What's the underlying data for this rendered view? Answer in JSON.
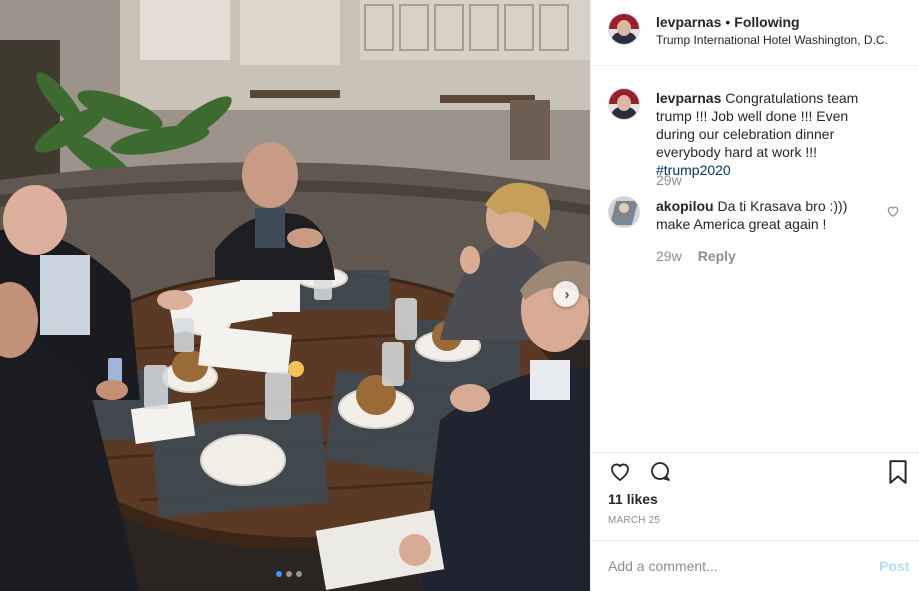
{
  "post": {
    "username": "levparnas",
    "separator": "•",
    "follow_status": "Following",
    "location": "Trump International Hotel Washington, D.C.",
    "photo_dots": 3,
    "active_dot": 0
  },
  "caption": {
    "username": "levparnas",
    "text": "Congratulations team trump !!! Job well done !!! Even during our celebration dinner everybody hard at work !!!",
    "hashtag": "#trump2020",
    "time": "29w"
  },
  "comments": [
    {
      "username": "akopilou",
      "text": "Da ti Krasava bro :))) make America great again !",
      "time": "29w",
      "reply_label": "Reply"
    }
  ],
  "actions": {
    "likes": "11 likes",
    "date": "MARCH 25"
  },
  "add_comment": {
    "placeholder": "Add a comment...",
    "post_label": "Post"
  },
  "colors": {
    "link_blue": "#003569",
    "muted": "#8e8e8e",
    "post_button_disabled": "#b2dffc",
    "carousel_active": "#3897f0"
  },
  "icons": [
    "heart-icon",
    "comment-icon",
    "bookmark-icon",
    "chevron-right-icon",
    "small-heart-icon"
  ]
}
